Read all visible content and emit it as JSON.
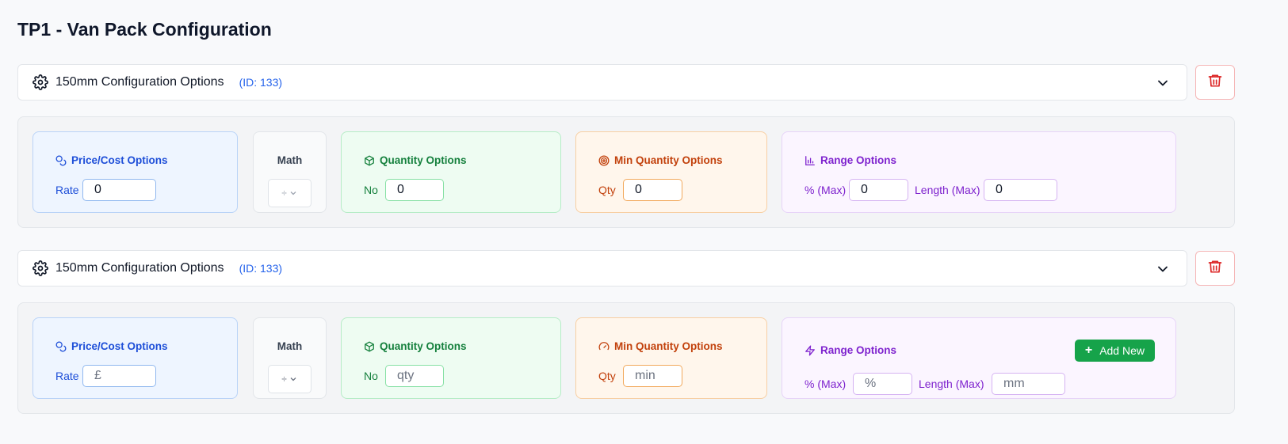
{
  "page": {
    "title": "TP1 - Van Pack Configuration"
  },
  "sections": [
    {
      "header": {
        "title": "150mm Configuration Options",
        "id_label": "(ID: 133)"
      },
      "price": {
        "title": "Price/Cost Options",
        "label": "Rate",
        "value": "0",
        "placeholder": ""
      },
      "math": {
        "title": "Math",
        "selected": "÷"
      },
      "quantity": {
        "title": "Quantity Options",
        "label": "No",
        "value": "0",
        "placeholder": ""
      },
      "min_quantity": {
        "title": "Min Quantity Options",
        "label": "Qty",
        "value": "0",
        "placeholder": ""
      },
      "range": {
        "title": "Range Options",
        "pct_label": "% (Max)",
        "pct_value": "0",
        "pct_placeholder": "",
        "len_label": "Length (Max)",
        "len_value": "0",
        "len_placeholder": ""
      }
    },
    {
      "header": {
        "title": "150mm Configuration Options",
        "id_label": "(ID: 133)"
      },
      "price": {
        "title": "Price/Cost Options",
        "label": "Rate",
        "value": "",
        "placeholder": "£"
      },
      "math": {
        "title": "Math",
        "selected": "÷"
      },
      "quantity": {
        "title": "Quantity Options",
        "label": "No",
        "value": "",
        "placeholder": "qty"
      },
      "min_quantity": {
        "title": "Min Quantity Options",
        "label": "Qty",
        "value": "",
        "placeholder": "min"
      },
      "range": {
        "title": "Range Options",
        "pct_label": "% (Max)",
        "pct_value": "",
        "pct_placeholder": "%",
        "len_label": "Length (Max)",
        "len_value": "",
        "len_placeholder": "mm",
        "add_label": "Add New"
      }
    }
  ],
  "icons": {
    "gear": "gear-icon",
    "chevron": "chevron-down-icon",
    "delete": "trash-icon",
    "price": "coins-icon",
    "quantity": "package-icon",
    "min_target": "target-icon",
    "min_gauge": "gauge-icon",
    "range_chart": "bar-chart-icon",
    "range_zap": "zap-icon",
    "add": "plus-icon"
  },
  "colors": {
    "id_blue": "#2563eb",
    "price_blue": "#1d4ed8",
    "quantity_green": "#15803d",
    "min_orange": "#c2410c",
    "range_purple": "#7e22ce",
    "delete_red": "#dc2626",
    "add_green": "#16a34a"
  }
}
